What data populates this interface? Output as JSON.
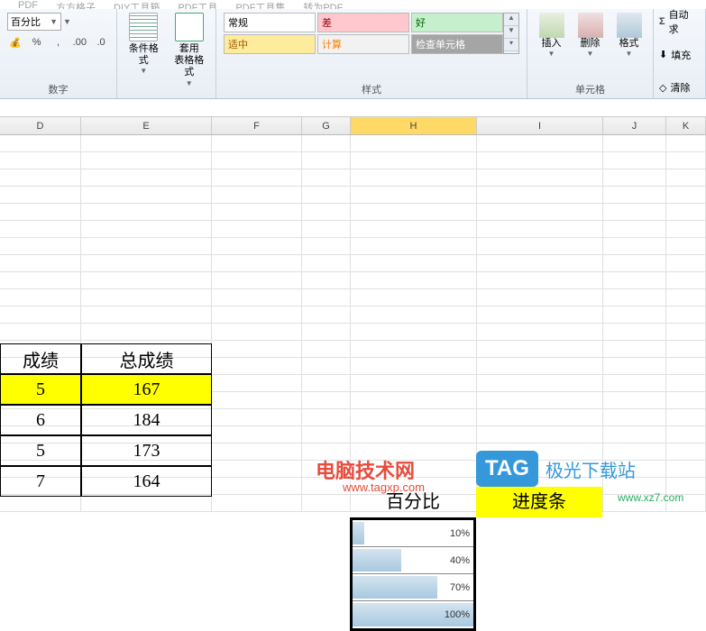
{
  "tabs": [
    "PDF",
    "方方格子",
    "DIY工具箱",
    "PDF工具",
    "PDF工具集",
    "转为PDF"
  ],
  "ribbon": {
    "number": {
      "dropdown": "百分比",
      "group_label": "数字"
    },
    "format": {
      "btn1": "条件格式",
      "btn2": "套用\n表格格式"
    },
    "styles": {
      "normal": "常规",
      "bad": "差",
      "good": "好",
      "neutral": "适中",
      "calc": "计算",
      "check": "检查单元格",
      "group_label": "样式"
    },
    "cells": {
      "insert": "插入",
      "delete": "删除",
      "format": "格式",
      "group_label": "单元格"
    },
    "edit": {
      "autosum": "自动求",
      "fill": "填充",
      "clear": "清除"
    }
  },
  "columns": [
    {
      "label": "D",
      "width": 90
    },
    {
      "label": "E",
      "width": 145
    },
    {
      "label": "F",
      "width": 100
    },
    {
      "label": "G",
      "width": 54
    },
    {
      "label": "H",
      "width": 140,
      "active": true
    },
    {
      "label": "I",
      "width": 140
    },
    {
      "label": "J",
      "width": 70
    },
    {
      "label": "K",
      "width": 44
    }
  ],
  "data_table": {
    "headers": [
      "成绩",
      "总成绩"
    ],
    "rows": [
      {
        "c1": "5",
        "c2": "167",
        "highlight": true
      },
      {
        "c1": "6",
        "c2": "184"
      },
      {
        "c1": "5",
        "c2": "173"
      },
      {
        "c1": "7",
        "c2": "164"
      }
    ]
  },
  "pct": {
    "header": "百分比",
    "values": [
      {
        "pct": 10,
        "label": "10%"
      },
      {
        "pct": 40,
        "label": "40%"
      },
      {
        "pct": 70,
        "label": "70%"
      },
      {
        "pct": 100,
        "label": "100%"
      }
    ]
  },
  "progress_header": "进度条",
  "watermarks": {
    "w1": "电脑技术网",
    "w1_sub": "www.tagxp.com",
    "w2_tag": "TAG",
    "w2_text": "极光下载站",
    "w2_sub": "www.xz7.com"
  }
}
